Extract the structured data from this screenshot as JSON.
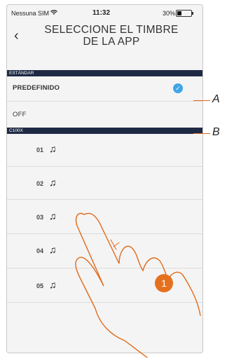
{
  "statusbar": {
    "carrier": "Nessuna SIM",
    "time": "11:32",
    "battery": "30%",
    "battery_level": 0.3
  },
  "header": {
    "title": "SELECCIONE EL TIMBRE DE LA APP"
  },
  "sections": {
    "standard": "ESTÁNDAR",
    "c100x": "C100X"
  },
  "standard_rows": {
    "predefined": "PREDEFINIDO",
    "off": "OFF"
  },
  "tones": [
    "01",
    "02",
    "03",
    "04",
    "05"
  ],
  "callouts": {
    "a": "A",
    "b": "B"
  },
  "step_badge": "1",
  "colors": {
    "section_bg": "#1e2a44",
    "check": "#3fa4e8",
    "callout": "#e06a1a",
    "badge": "#e5711f"
  },
  "icons": {
    "back": "chevron-left-icon",
    "wifi": "wifi-icon",
    "battery": "battery-icon",
    "check": "check-circle-icon",
    "tone": "music-note-icon"
  }
}
